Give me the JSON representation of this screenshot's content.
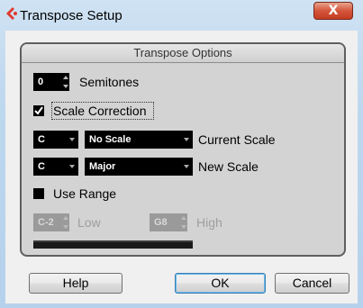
{
  "window": {
    "title": "Transpose Setup",
    "close_symbol": "X"
  },
  "panel": {
    "header": "Transpose Options"
  },
  "semitones": {
    "value": "0",
    "label": "Semitones"
  },
  "scale_correction": {
    "label": "Scale Correction",
    "checked": true
  },
  "current_scale": {
    "root": "C",
    "scale": "No Scale",
    "label": "Current Scale"
  },
  "new_scale": {
    "root": "C",
    "scale": "Major",
    "label": "New Scale"
  },
  "use_range": {
    "label": "Use Range",
    "checked": false
  },
  "range": {
    "low_value": "C-2",
    "low_label": "Low",
    "high_value": "G8",
    "high_label": "High"
  },
  "buttons": {
    "help": "Help",
    "ok": "OK",
    "cancel": "Cancel"
  },
  "colors": {
    "accent": "#3c7fb1",
    "app_icon": "#e03a2f"
  }
}
